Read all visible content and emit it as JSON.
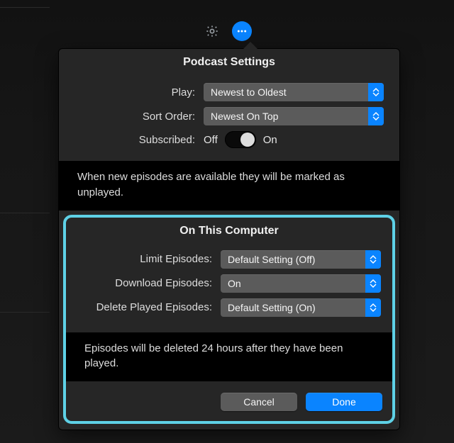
{
  "header": {
    "settings_icon": "gear-icon",
    "more_icon": "ellipsis-icon"
  },
  "popover": {
    "title": "Podcast Settings",
    "play_label": "Play:",
    "play_value": "Newest to Oldest",
    "sort_label": "Sort Order:",
    "sort_value": "Newest On Top",
    "subscribed_label": "Subscribed:",
    "subscribed_off": "Off",
    "subscribed_on": "On",
    "subscribed_state": "on",
    "note1": "When new episodes are available they will be marked as unplayed."
  },
  "section": {
    "title": "On This Computer",
    "limit_label": "Limit Episodes:",
    "limit_value": "Default Setting (Off)",
    "download_label": "Download Episodes:",
    "download_value": "On",
    "delete_label": "Delete Played Episodes:",
    "delete_value": "Default Setting (On)",
    "note2": "Episodes will be deleted 24 hours after they have been played."
  },
  "footer": {
    "cancel": "Cancel",
    "done": "Done"
  }
}
